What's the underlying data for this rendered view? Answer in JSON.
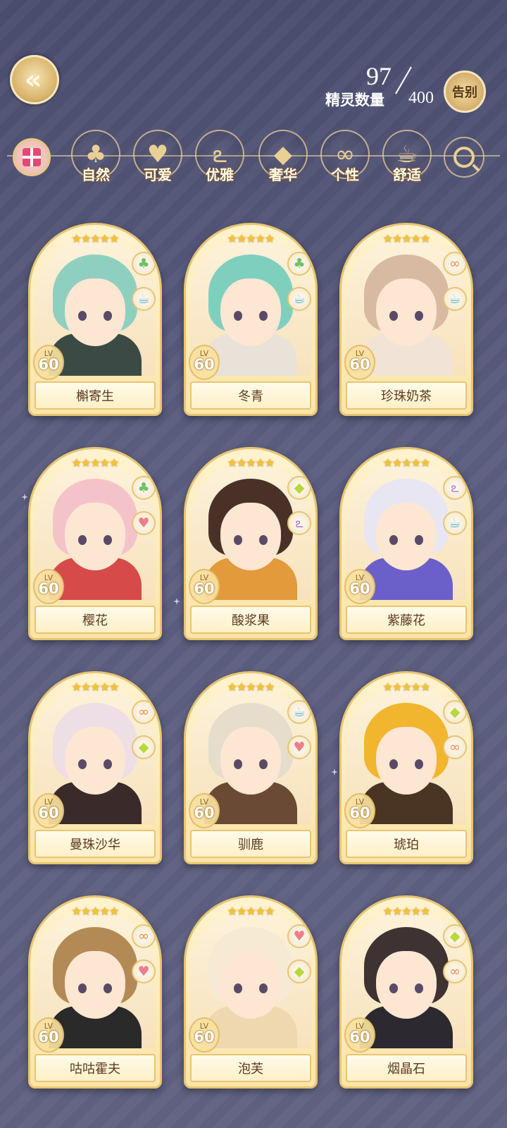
{
  "header": {
    "count_current": "97",
    "count_label": "精灵数量",
    "count_max": "400",
    "farewell_label": "告别"
  },
  "filters": [
    {
      "label": "自然",
      "icon": "clover-icon",
      "glyph": "♣"
    },
    {
      "label": "可爱",
      "icon": "heart-icon",
      "glyph": "♥"
    },
    {
      "label": "优雅",
      "icon": "swan-icon",
      "glyph": "ఽ"
    },
    {
      "label": "奢华",
      "icon": "diamond-icon",
      "glyph": "◆"
    },
    {
      "label": "个性",
      "icon": "glasses-icon",
      "glyph": "∞"
    },
    {
      "label": "舒适",
      "icon": "teacup-icon",
      "glyph": "☕"
    }
  ],
  "cards": [
    {
      "name": "槲寄生",
      "level": "60",
      "lv_label": "LV",
      "stars": "★★★★★",
      "badges": [
        "clover-icon",
        "teacup-icon"
      ],
      "hair": "#8fcfbf",
      "cloth": "#3b4a44"
    },
    {
      "name": "冬青",
      "level": "60",
      "lv_label": "LV",
      "stars": "★★★★★",
      "badges": [
        "clover-icon",
        "teacup-icon"
      ],
      "hair": "#7fcfbe",
      "cloth": "#e9e2d8"
    },
    {
      "name": "珍珠奶茶",
      "level": "60",
      "lv_label": "LV",
      "stars": "★★★★★",
      "badges": [
        "glasses-icon",
        "teacup-icon"
      ],
      "hair": "#d8b9a2",
      "cloth": "#f1e3d6"
    },
    {
      "name": "樱花",
      "level": "60",
      "lv_label": "LV",
      "stars": "★★★★★",
      "badges": [
        "clover-icon",
        "heart-icon"
      ],
      "hair": "#f4c3c9",
      "cloth": "#d64a4a"
    },
    {
      "name": "酸浆果",
      "level": "60",
      "lv_label": "LV",
      "stars": "★★★★★",
      "badges": [
        "diamond-icon",
        "swan-icon"
      ],
      "hair": "#4a3128",
      "cloth": "#e29a3a"
    },
    {
      "name": "紫藤花",
      "level": "60",
      "lv_label": "LV",
      "stars": "★★★★★",
      "badges": [
        "swan-icon",
        "teacup-icon"
      ],
      "hair": "#e8e6f2",
      "cloth": "#6b5fc9"
    },
    {
      "name": "曼珠沙华",
      "level": "60",
      "lv_label": "LV",
      "stars": "★★★★★",
      "badges": [
        "glasses-icon",
        "diamond-icon"
      ],
      "hair": "#eedfe6",
      "cloth": "#3a2a2a"
    },
    {
      "name": "驯鹿",
      "level": "60",
      "lv_label": "LV",
      "stars": "★★★★★",
      "badges": [
        "teacup-icon",
        "heart-icon"
      ],
      "hair": "#e6ddcd",
      "cloth": "#6a4a34"
    },
    {
      "name": "琥珀",
      "level": "60",
      "lv_label": "LV",
      "stars": "★★★★★",
      "badges": [
        "diamond-icon",
        "glasses-icon"
      ],
      "hair": "#f2b52e",
      "cloth": "#4a3424"
    },
    {
      "name": "咕咕霍夫",
      "level": "60",
      "lv_label": "LV",
      "stars": "★★★★★",
      "badges": [
        "glasses-icon",
        "heart-icon"
      ],
      "hair": "#b38a55",
      "cloth": "#2a2a2a"
    },
    {
      "name": "泡芙",
      "level": "60",
      "lv_label": "LV",
      "stars": "★★★★★",
      "badges": [
        "heart-icon",
        "diamond-icon"
      ],
      "hair": "#f6ead4",
      "cloth": "#efd7b0"
    },
    {
      "name": "烟晶石",
      "level": "60",
      "lv_label": "LV",
      "stars": "★★★★★",
      "badges": [
        "diamond-icon",
        "glasses-icon"
      ],
      "hair": "#3e3232",
      "cloth": "#2c2a30"
    }
  ],
  "badge_glyphs": {
    "clover-icon": {
      "glyph": "♣",
      "color": "#6fc06a"
    },
    "heart-icon": {
      "glyph": "♥",
      "color": "#f07c8a"
    },
    "teacup-icon": {
      "glyph": "☕",
      "color": "#5fb6d4"
    },
    "diamond-icon": {
      "glyph": "◆",
      "color": "#b9d83a"
    },
    "swan-icon": {
      "glyph": "ఽ",
      "color": "#b07ad6"
    },
    "glasses-icon": {
      "glyph": "∞",
      "color": "#f08a4a"
    }
  }
}
